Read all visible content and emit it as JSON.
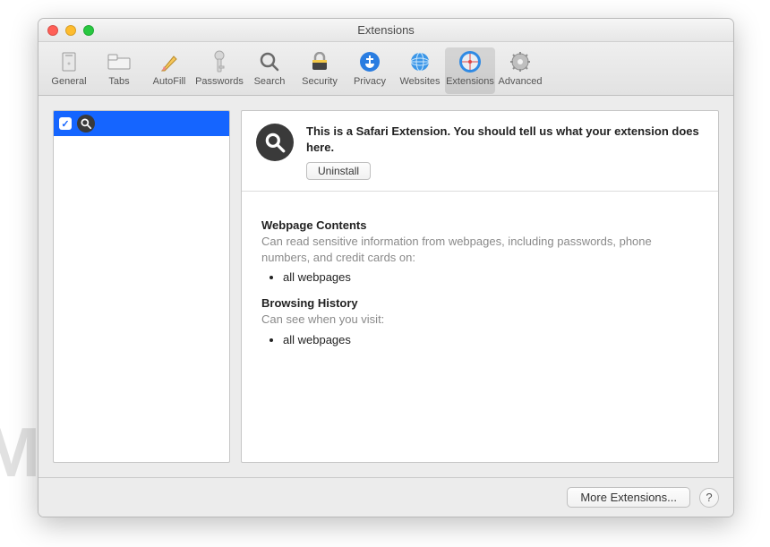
{
  "window": {
    "title": "Extensions"
  },
  "toolbar": {
    "items": [
      {
        "label": "General"
      },
      {
        "label": "Tabs"
      },
      {
        "label": "AutoFill"
      },
      {
        "label": "Passwords"
      },
      {
        "label": "Search"
      },
      {
        "label": "Security"
      },
      {
        "label": "Privacy"
      },
      {
        "label": "Websites"
      },
      {
        "label": "Extensions"
      },
      {
        "label": "Advanced"
      }
    ]
  },
  "extension": {
    "description": "This is a Safari Extension. You should tell us what your extension does here.",
    "uninstall_label": "Uninstall"
  },
  "permissions": {
    "webpage_title": "Webpage Contents",
    "webpage_desc": "Can read sensitive information from webpages, including passwords, phone numbers, and credit cards on:",
    "webpage_item": "all webpages",
    "history_title": "Browsing History",
    "history_desc": "Can see when you visit:",
    "history_item": "all webpages"
  },
  "footer": {
    "more_label": "More Extensions...",
    "help_label": "?"
  },
  "watermark": "MALWARETIPS"
}
